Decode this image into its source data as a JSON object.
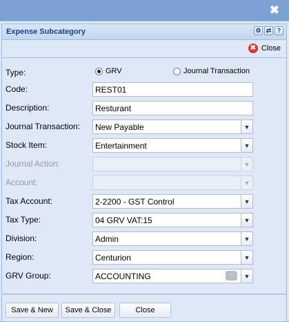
{
  "window": {
    "title": "Expense Subcategory",
    "close_label": "Close"
  },
  "type_field": {
    "label": "Type:",
    "options": [
      "GRV",
      "Journal Transaction"
    ],
    "selected": "GRV"
  },
  "fields": {
    "code": {
      "label": "Code:",
      "value": "REST01"
    },
    "description": {
      "label": "Description:",
      "value": "Resturant"
    },
    "journal_transaction": {
      "label": "Journal Transaction:",
      "value": "New Payable"
    },
    "stock_item": {
      "label": "Stock Item:",
      "value": "Entertainment"
    },
    "journal_action": {
      "label": "Journal Action:",
      "value": "",
      "disabled": true
    },
    "account": {
      "label": "Account:",
      "value": "",
      "disabled": true
    },
    "tax_account": {
      "label": "Tax Account:",
      "value": "2-2200 - GST Control"
    },
    "tax_type": {
      "label": "Tax Type:",
      "value": "04 GRV VAT:15"
    },
    "division": {
      "label": "Division:",
      "value": "Admin"
    },
    "region": {
      "label": "Region:",
      "value": "Centurion"
    },
    "grv_group": {
      "label": "GRV Group:",
      "value": "ACCOUNTING"
    }
  },
  "buttons": {
    "save_new": "Save & New",
    "save_close": "Save & Close",
    "close": "Close"
  },
  "icons": {
    "top_close": "✖",
    "close_circle": "✖",
    "chevron": "▼",
    "ellipsis": "···",
    "settings": "⚙",
    "refresh": "⇄",
    "help": "?"
  },
  "colors": {
    "header_text": "#15428b",
    "close_red": "#e0352b",
    "panel_bg": "#dfe8f6"
  }
}
